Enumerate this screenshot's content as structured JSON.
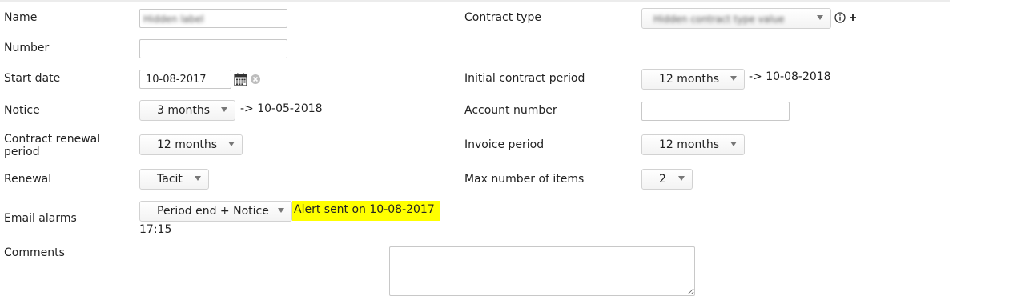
{
  "form": {
    "name": {
      "label": "Name",
      "value": "Hidden label"
    },
    "number": {
      "label": "Number",
      "value": ""
    },
    "start_date": {
      "label": "Start date",
      "value": "10-08-2017"
    },
    "notice": {
      "label": "Notice",
      "value": "3 months",
      "computed": "-> 10-05-2018"
    },
    "renewal_period": {
      "label": "Contract renewal period",
      "value": "12 months"
    },
    "renewal": {
      "label": "Renewal",
      "value": "Tacit"
    },
    "email_alarms": {
      "label": "Email alarms",
      "value": "Period end + Notice",
      "alert": "Alert sent on 10-08-2017",
      "time": "17:15"
    },
    "comments": {
      "label": "Comments",
      "value": ""
    },
    "contract_type": {
      "label": "Contract type",
      "value": "Hidden contract type value"
    },
    "initial_period": {
      "label": "Initial contract period",
      "value": "12 months",
      "computed": "-> 10-08-2018"
    },
    "account_number": {
      "label": "Account number",
      "value": ""
    },
    "invoice_period": {
      "label": "Invoice period",
      "value": "12 months"
    },
    "max_items": {
      "label": "Max number of items",
      "value": "2"
    }
  },
  "icons": {
    "calendar": "calendar-icon",
    "clear": "clear-date-icon",
    "info": "info-icon",
    "add": "add-icon"
  },
  "colors": {
    "alert_background": "#ffff00",
    "border": "#c8c8c8"
  }
}
